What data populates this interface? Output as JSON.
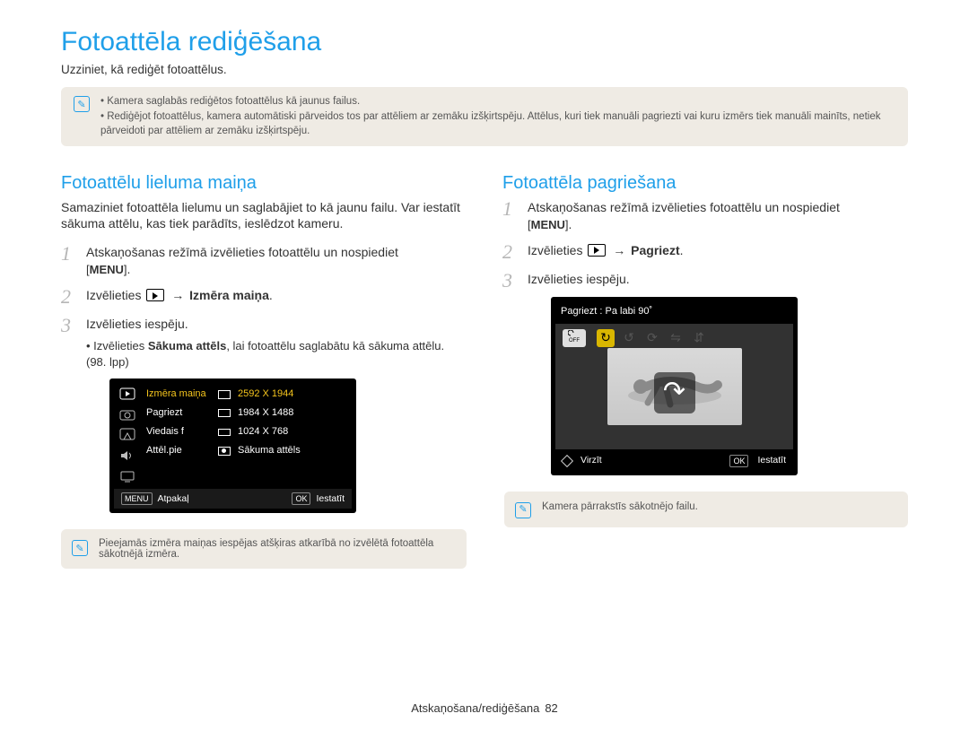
{
  "page": {
    "title": "Fotoattēla rediģēšana",
    "subtitle": "Uzziniet, kā rediģēt fotoattēlus.",
    "footer_section": "Atskaņošana/rediģēšana",
    "page_number": "82"
  },
  "top_note": {
    "items": [
      "Kamera saglabās rediģētos fotoattēlus kā jaunus failus.",
      "Rediģējot fotoattēlus, kamera automātiski pārveidos tos par attēliem ar zemāku izšķirtspēju. Attēlus, kuri tiek manuāli pagriezti vai kuru izmērs tiek manuāli mainīts, netiek pārveidoti par attēliem ar zemāku izšķirtspēju."
    ]
  },
  "left": {
    "section_title": "Fotoattēlu lieluma maiņa",
    "section_desc": "Samaziniet fotoattēla lielumu un saglabājiet to kā jaunu failu. Var iestatīt sākuma attēlu, kas tiek parādīts, ieslēdzot kameru.",
    "step1_a": "Atskaņošanas režīmā izvēlieties fotoattēlu un nospiediet ",
    "menu_label": "MENU",
    "step2_a": "Izvēlieties ",
    "step2_b": "Izmēra maiņa",
    "step3": "Izvēlieties iespēju.",
    "step3_sub_a": "Izvēlieties ",
    "step3_sub_b": "Sākuma attēls",
    "step3_sub_c": ", lai fotoattēlu saglabātu kā sākuma attēlu. (98. lpp)",
    "lcd": {
      "rows": [
        {
          "label": "Izmēra maiņa",
          "value": "2592 X 1944",
          "selected": true,
          "mini": "s1"
        },
        {
          "label": "Pagriezt",
          "value": "1984 X 1488",
          "selected": false,
          "mini": "s2"
        },
        {
          "label": "Viedais f",
          "value": "1024 X 768",
          "selected": false,
          "mini": "s3"
        },
        {
          "label": "Attēl.pie",
          "value": "Sākuma attēls",
          "selected": false,
          "mini": "start"
        }
      ],
      "footer_back_key": "MENU",
      "footer_back": "Atpakaļ",
      "footer_ok_key": "OK",
      "footer_ok": "Iestatīt"
    },
    "bottom_note": "Pieejamās izmēra maiņas iespējas atšķiras atkarībā no izvēlētā fotoattēla sākotnējā izmēra."
  },
  "right": {
    "section_title": "Fotoattēla pagriešana",
    "step1_a": "Atskaņošanas režīmā izvēlieties fotoattēlu un nospiediet ",
    "menu_label": "MENU",
    "step2_a": "Izvēlieties ",
    "step2_b": "Pagriezt",
    "step3": "Izvēlieties iespēju.",
    "lcd": {
      "header": "Pagriezt : Pa labi 90˚",
      "badge_off": "OFF",
      "footer_move": "Virzīt",
      "footer_ok_key": "OK",
      "footer_ok": "Iestatīt"
    },
    "bottom_note": "Kamera pārrakstīs sākotnējo failu."
  }
}
